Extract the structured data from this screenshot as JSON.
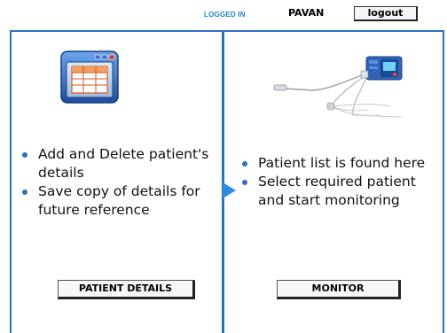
{
  "header": {
    "logged_in_label": "LOGGED IN",
    "username": "PAVAN",
    "logout_label": "logout"
  },
  "left_panel": {
    "icon": "table-window-icon",
    "bullets": [
      "Add and Delete patient's details",
      "Save copy of details for future reference"
    ],
    "button_label": "PATIENT DETAILS"
  },
  "right_panel": {
    "icon": "monitor-device-icon",
    "bullets": [
      "Patient list is found here",
      "Select required patient and start monitoring"
    ],
    "button_label": "MONITOR"
  },
  "colors": {
    "accent": "#2f6fc2",
    "logged_in_text": "#1b7fd0",
    "arrow": "#2b8be8"
  }
}
